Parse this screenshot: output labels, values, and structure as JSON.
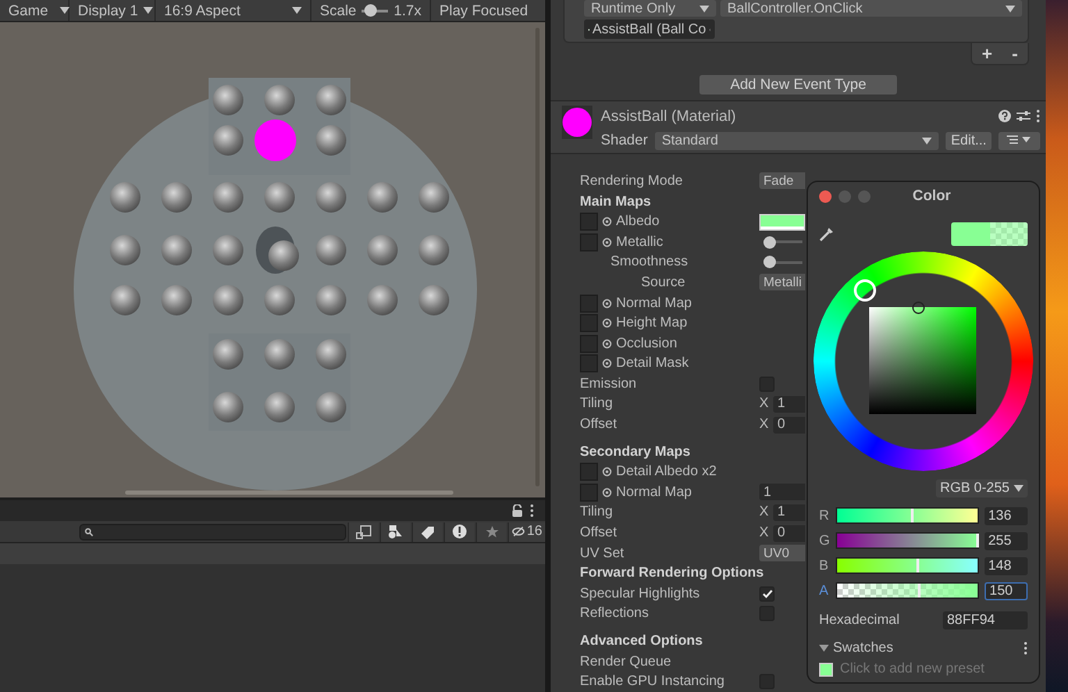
{
  "game_toolbar": {
    "view": "Game",
    "display": "Display 1",
    "aspect": "16:9 Aspect",
    "scale_label": "Scale",
    "scale": {
      "level": 0.3
    },
    "scale_value": "1.7x",
    "play_mode": "Play Focused"
  },
  "project_toolbar": {
    "hidden_count": "16"
  },
  "inspector": {
    "event": {
      "mode": "Runtime Only",
      "function": "BallController.OnClick",
      "target": "AssistBall (Ball Co",
      "add": "+",
      "remove": "-"
    },
    "add_event_button": "Add New Event Type",
    "material": {
      "name": "AssistBall (Material)",
      "shader_label": "Shader",
      "shader": "Standard",
      "edit_button": "Edit..."
    },
    "properties": [
      {
        "kind": "dropdown",
        "label": "Rendering Mode",
        "value": "Fade"
      },
      {
        "kind": "header",
        "label": "Main Maps"
      },
      {
        "kind": "texture",
        "label": "Albedo",
        "color": "#88ff94"
      },
      {
        "kind": "texture",
        "label": "Metallic",
        "level": 0,
        "children": [
          {
            "kind": "slider",
            "label": "Smoothness",
            "level": 0,
            "children": [
              {
                "kind": "dropdown",
                "label": "Source",
                "value": "Metalli"
              }
            ]
          }
        ]
      },
      {
        "kind": "texture",
        "label": "Normal Map"
      },
      {
        "kind": "texture",
        "label": "Height Map"
      },
      {
        "kind": "texture",
        "label": "Occlusion"
      },
      {
        "kind": "texture",
        "label": "Detail Mask"
      },
      {
        "kind": "checkbox",
        "label": "Emission",
        "checked": false
      },
      {
        "kind": "vector",
        "label": "Tiling",
        "axis": "X",
        "value": "1"
      },
      {
        "kind": "vector",
        "label": "Offset",
        "axis": "X",
        "value": "0"
      },
      {
        "kind": "spacer"
      },
      {
        "kind": "header",
        "label": "Secondary Maps"
      },
      {
        "kind": "texture",
        "label": "Detail Albedo x2"
      },
      {
        "kind": "texture",
        "label": "Normal Map",
        "value": "1"
      },
      {
        "kind": "vector",
        "label": "Tiling",
        "axis": "X",
        "value": "1"
      },
      {
        "kind": "vector",
        "label": "Offset",
        "axis": "X",
        "value": "0"
      },
      {
        "kind": "dropdown",
        "label": "UV Set",
        "value": "UV0"
      },
      {
        "kind": "header",
        "label": "Forward Rendering Options"
      },
      {
        "kind": "checkbox",
        "label": "Specular Highlights",
        "checked": true
      },
      {
        "kind": "checkbox",
        "label": "Reflections",
        "checked": false
      },
      {
        "kind": "spacer"
      },
      {
        "kind": "header",
        "label": "Advanced Options"
      },
      {
        "kind": "plain",
        "label": "Render Queue"
      },
      {
        "kind": "checkbox",
        "label": "Enable GPU Instancing",
        "checked": false
      }
    ]
  },
  "color_picker": {
    "title": "Color",
    "mode": "RGB 0-255",
    "channels": [
      {
        "name": "R",
        "value": "136",
        "level": 0.533,
        "selected": false
      },
      {
        "name": "G",
        "value": "255",
        "level": 1,
        "selected": false
      },
      {
        "name": "B",
        "value": "148",
        "level": 0.58,
        "selected": false
      },
      {
        "name": "A",
        "value": "150",
        "level": 0.588,
        "selected": true
      }
    ],
    "hex_label": "Hexadecimal",
    "hex": "88FF94",
    "swatches_label": "Swatches",
    "swatches_expanded": true,
    "add_preset": "Click to add new preset"
  }
}
